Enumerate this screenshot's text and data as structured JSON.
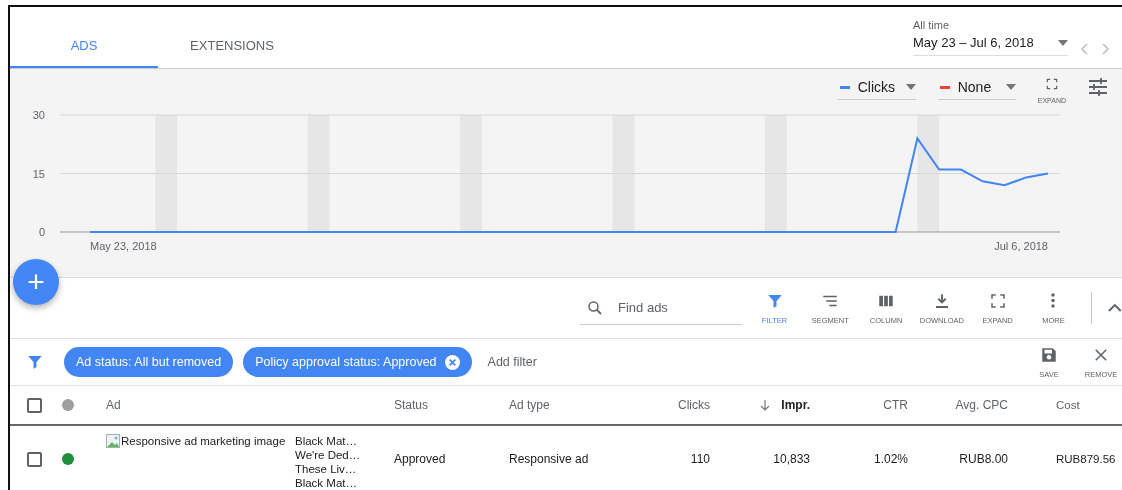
{
  "tabs": [
    {
      "label": "ADS",
      "selected": true
    },
    {
      "label": "EXTENSIONS",
      "selected": false
    }
  ],
  "date_range": {
    "label": "All time",
    "value": "May 23 – Jul 6, 2018"
  },
  "chart_controls": {
    "metrics": [
      {
        "label": "Clicks",
        "color": "#4285f4"
      },
      {
        "label": "None",
        "color": "#ea4335"
      }
    ],
    "expand_label": "EXPAND"
  },
  "chart": {
    "x_axis_labels": [
      "May 23, 2018",
      "Jul 6, 2018"
    ],
    "chart_data": {
      "type": "line",
      "ylim": [
        0,
        30
      ],
      "yticks": [
        0,
        15,
        30
      ],
      "series": [
        {
          "color": "#4285f4",
          "values": [
            0,
            0,
            0,
            0,
            0,
            0,
            0,
            0,
            0,
            0,
            0,
            0,
            0,
            0,
            0,
            0,
            0,
            0,
            0,
            0,
            0,
            0,
            0,
            0,
            0,
            0,
            0,
            0,
            0,
            0,
            0,
            0,
            0,
            0,
            0,
            0,
            0,
            0,
            24,
            16,
            16,
            13,
            12,
            14,
            15
          ]
        }
      ]
    }
  },
  "add_button": {
    "label": "+"
  },
  "toolbar": {
    "search": {
      "placeholder": "Find ads"
    },
    "actions": [
      {
        "kind": "filter",
        "label": "FILTER",
        "selected": true
      },
      {
        "kind": "segment",
        "label": "SEGMENT",
        "selected": false
      },
      {
        "kind": "column",
        "label": "COLUMN",
        "selected": false
      },
      {
        "kind": "download",
        "label": "DOWNLOAD",
        "selected": false
      },
      {
        "kind": "expand",
        "label": "EXPAND",
        "selected": false
      },
      {
        "kind": "more",
        "label": "MORE",
        "selected": false
      }
    ]
  },
  "filters": {
    "chips": [
      {
        "label": "Ad status: All but removed",
        "removable": false
      },
      {
        "label": "Policy approval status: Approved",
        "removable": true
      }
    ],
    "add_filter": "Add filter",
    "actions": [
      {
        "kind": "save",
        "label": "SAVE"
      },
      {
        "kind": "remove",
        "label": "REMOVE"
      }
    ]
  },
  "table": {
    "select_all_checked": false,
    "columns": [
      {
        "label": "Ad",
        "sorted": false
      },
      {
        "label": "Status",
        "sorted": false
      },
      {
        "label": "Ad type",
        "sorted": false
      },
      {
        "label": "Clicks",
        "sorted": false
      },
      {
        "label": "Impr.",
        "sorted": true
      },
      {
        "label": "CTR",
        "sorted": false
      },
      {
        "label": "Avg. CPC",
        "sorted": false
      },
      {
        "label": "Cost",
        "sorted": false
      }
    ],
    "rows": [
      {
        "checked": false,
        "color": "#1e8e3e",
        "image_alt": "Responsive ad marketing image",
        "headlines": [
          "Black Mat…",
          "We're Ded…",
          "These Liv…",
          "Black Mat…"
        ],
        "status": "Approved",
        "ad_type": "Responsive ad",
        "clicks": "110",
        "impr": "10,833",
        "ctr": "1.02%",
        "avg_cpc": "RUB8.00",
        "cost": "RUB879.56"
      }
    ]
  }
}
